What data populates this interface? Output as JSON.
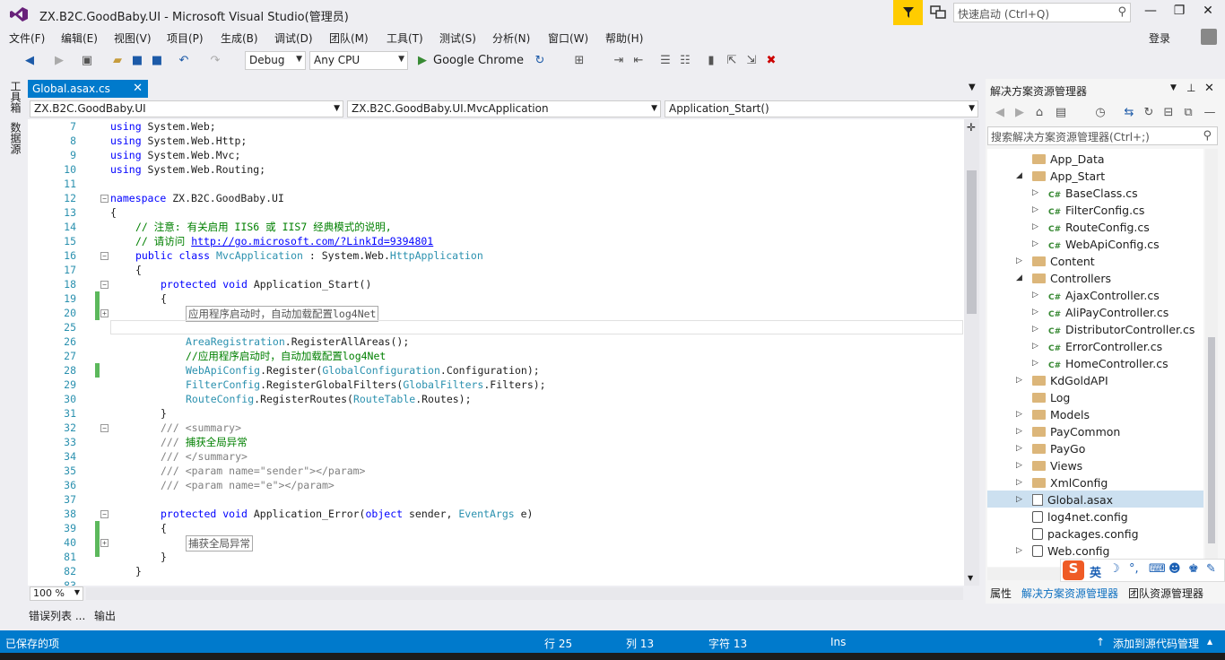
{
  "window": {
    "title": "ZX.B2C.GoodBaby.UI - Microsoft Visual Studio(管理员)",
    "quick_launch_placeholder": "快速启动 (Ctrl+Q)",
    "login": "登录"
  },
  "menu": [
    "文件(F)",
    "编辑(E)",
    "视图(V)",
    "项目(P)",
    "生成(B)",
    "调试(D)",
    "团队(M)",
    "工具(T)",
    "测试(S)",
    "分析(N)",
    "窗口(W)",
    "帮助(H)"
  ],
  "toolbar": {
    "config": "Debug",
    "platform": "Any CPU",
    "run_target": "Google Chrome"
  },
  "left_tabs": [
    "工具箱",
    "数据源"
  ],
  "editor": {
    "tab_title": "Global.asax.cs",
    "nav_project": "ZX.B2C.GoodBaby.UI",
    "nav_class": "ZX.B2C.GoodBaby.UI.MvcApplication",
    "nav_member": "Application_Start()",
    "zoom": "100 %",
    "lines": [
      {
        "n": "7",
        "t": "using System.Web;"
      },
      {
        "n": "8",
        "t": "using System.Web.Http;"
      },
      {
        "n": "9",
        "t": "using System.Web.Mvc;"
      },
      {
        "n": "10",
        "t": "using System.Web.Routing;"
      },
      {
        "n": "11",
        "t": ""
      },
      {
        "n": "12",
        "t": "namespace ZX.B2C.GoodBaby.UI"
      },
      {
        "n": "13",
        "t": "{"
      },
      {
        "n": "14",
        "t": "// 注意: 有关启用 IIS6 或 IIS7 经典模式的说明,"
      },
      {
        "n": "15",
        "t": "// 请访问 ",
        "link": "http://go.microsoft.com/?LinkId=9394801"
      },
      {
        "n": "16",
        "t": "public class MvcApplication : System.Web.HttpApplication"
      },
      {
        "n": "17",
        "t": "{"
      },
      {
        "n": "18",
        "t": "protected void Application_Start()"
      },
      {
        "n": "19",
        "t": "{"
      },
      {
        "n": "20",
        "t": "应用程序启动时，自动加载配置log4Net"
      },
      {
        "n": "25",
        "t": ""
      },
      {
        "n": "26",
        "t": "AreaRegistration.RegisterAllAreas();"
      },
      {
        "n": "27",
        "t": "//应用程序启动时，自动加载配置log4Net"
      },
      {
        "n": "28",
        "t": "WebApiConfig.Register(GlobalConfiguration.Configuration);"
      },
      {
        "n": "29",
        "t": "FilterConfig.RegisterGlobalFilters(GlobalFilters.Filters);"
      },
      {
        "n": "30",
        "t": "RouteConfig.RegisterRoutes(RouteTable.Routes);"
      },
      {
        "n": "31",
        "t": "}"
      },
      {
        "n": "32",
        "t": "/// <summary>"
      },
      {
        "n": "33",
        "t": "/// 捕获全局异常"
      },
      {
        "n": "34",
        "t": "/// </summary>"
      },
      {
        "n": "35",
        "t": "/// <param name=\"sender\"></param>"
      },
      {
        "n": "36",
        "t": "/// <param name=\"e\"></param>"
      },
      {
        "n": "37",
        "t": ""
      },
      {
        "n": "38",
        "t": "protected void Application_Error(object sender, EventArgs e)"
      },
      {
        "n": "39",
        "t": "{"
      },
      {
        "n": "40",
        "t": "捕获全局异常"
      },
      {
        "n": "81",
        "t": "}"
      },
      {
        "n": "82",
        "t": "}"
      },
      {
        "n": "83",
        "t": ""
      }
    ]
  },
  "bottom_tabs": [
    "错误列表 ...",
    "输出"
  ],
  "solution_explorer": {
    "title": "解决方案资源管理器",
    "search_placeholder": "搜索解决方案资源管理器(Ctrl+;)",
    "items": [
      {
        "label": "App_Data",
        "kind": "folder",
        "depth": 1,
        "expand": ""
      },
      {
        "label": "App_Start",
        "kind": "folder",
        "depth": 1,
        "expand": "open"
      },
      {
        "label": "BaseClass.cs",
        "kind": "cs",
        "depth": 2,
        "expand": "closed"
      },
      {
        "label": "FilterConfig.cs",
        "kind": "cs",
        "depth": 2,
        "expand": "closed"
      },
      {
        "label": "RouteConfig.cs",
        "kind": "cs",
        "depth": 2,
        "expand": "closed"
      },
      {
        "label": "WebApiConfig.cs",
        "kind": "cs",
        "depth": 2,
        "expand": "closed"
      },
      {
        "label": "Content",
        "kind": "folder",
        "depth": 1,
        "expand": "closed"
      },
      {
        "label": "Controllers",
        "kind": "folder",
        "depth": 1,
        "expand": "open"
      },
      {
        "label": "AjaxController.cs",
        "kind": "cs",
        "depth": 2,
        "expand": "closed"
      },
      {
        "label": "AliPayController.cs",
        "kind": "cs",
        "depth": 2,
        "expand": "closed"
      },
      {
        "label": "DistributorController.cs",
        "kind": "cs",
        "depth": 2,
        "expand": "closed"
      },
      {
        "label": "ErrorController.cs",
        "kind": "cs",
        "depth": 2,
        "expand": "closed"
      },
      {
        "label": "HomeController.cs",
        "kind": "cs",
        "depth": 2,
        "expand": "closed"
      },
      {
        "label": "KdGoldAPI",
        "kind": "folder",
        "depth": 1,
        "expand": "closed"
      },
      {
        "label": "Log",
        "kind": "folder",
        "depth": 1,
        "expand": ""
      },
      {
        "label": "Models",
        "kind": "folder",
        "depth": 1,
        "expand": "closed"
      },
      {
        "label": "PayCommon",
        "kind": "folder",
        "depth": 1,
        "expand": "closed"
      },
      {
        "label": "PayGo",
        "kind": "folder",
        "depth": 1,
        "expand": "closed"
      },
      {
        "label": "Views",
        "kind": "folder",
        "depth": 1,
        "expand": "closed"
      },
      {
        "label": "XmlConfig",
        "kind": "folder",
        "depth": 1,
        "expand": "closed"
      },
      {
        "label": "Global.asax",
        "kind": "global",
        "depth": 1,
        "expand": "closed"
      },
      {
        "label": "log4net.config",
        "kind": "config",
        "depth": 1,
        "expand": ""
      },
      {
        "label": "packages.config",
        "kind": "config",
        "depth": 1,
        "expand": ""
      },
      {
        "label": "Web.config",
        "kind": "config",
        "depth": 1,
        "expand": "closed"
      }
    ],
    "selected": "Global.asax",
    "bottom_tabs": [
      "属性",
      "解决方案资源管理器",
      "团队资源管理器"
    ]
  },
  "ime": {
    "mode": "英"
  },
  "status": {
    "message": "已保存的项",
    "row": "行 25",
    "col": "列 13",
    "char": "字符 13",
    "ins": "Ins",
    "source_control": "添加到源代码管理"
  },
  "colors": {
    "accent": "#007acc",
    "filter": "#ffcc00",
    "selection": "#cce0f0"
  }
}
